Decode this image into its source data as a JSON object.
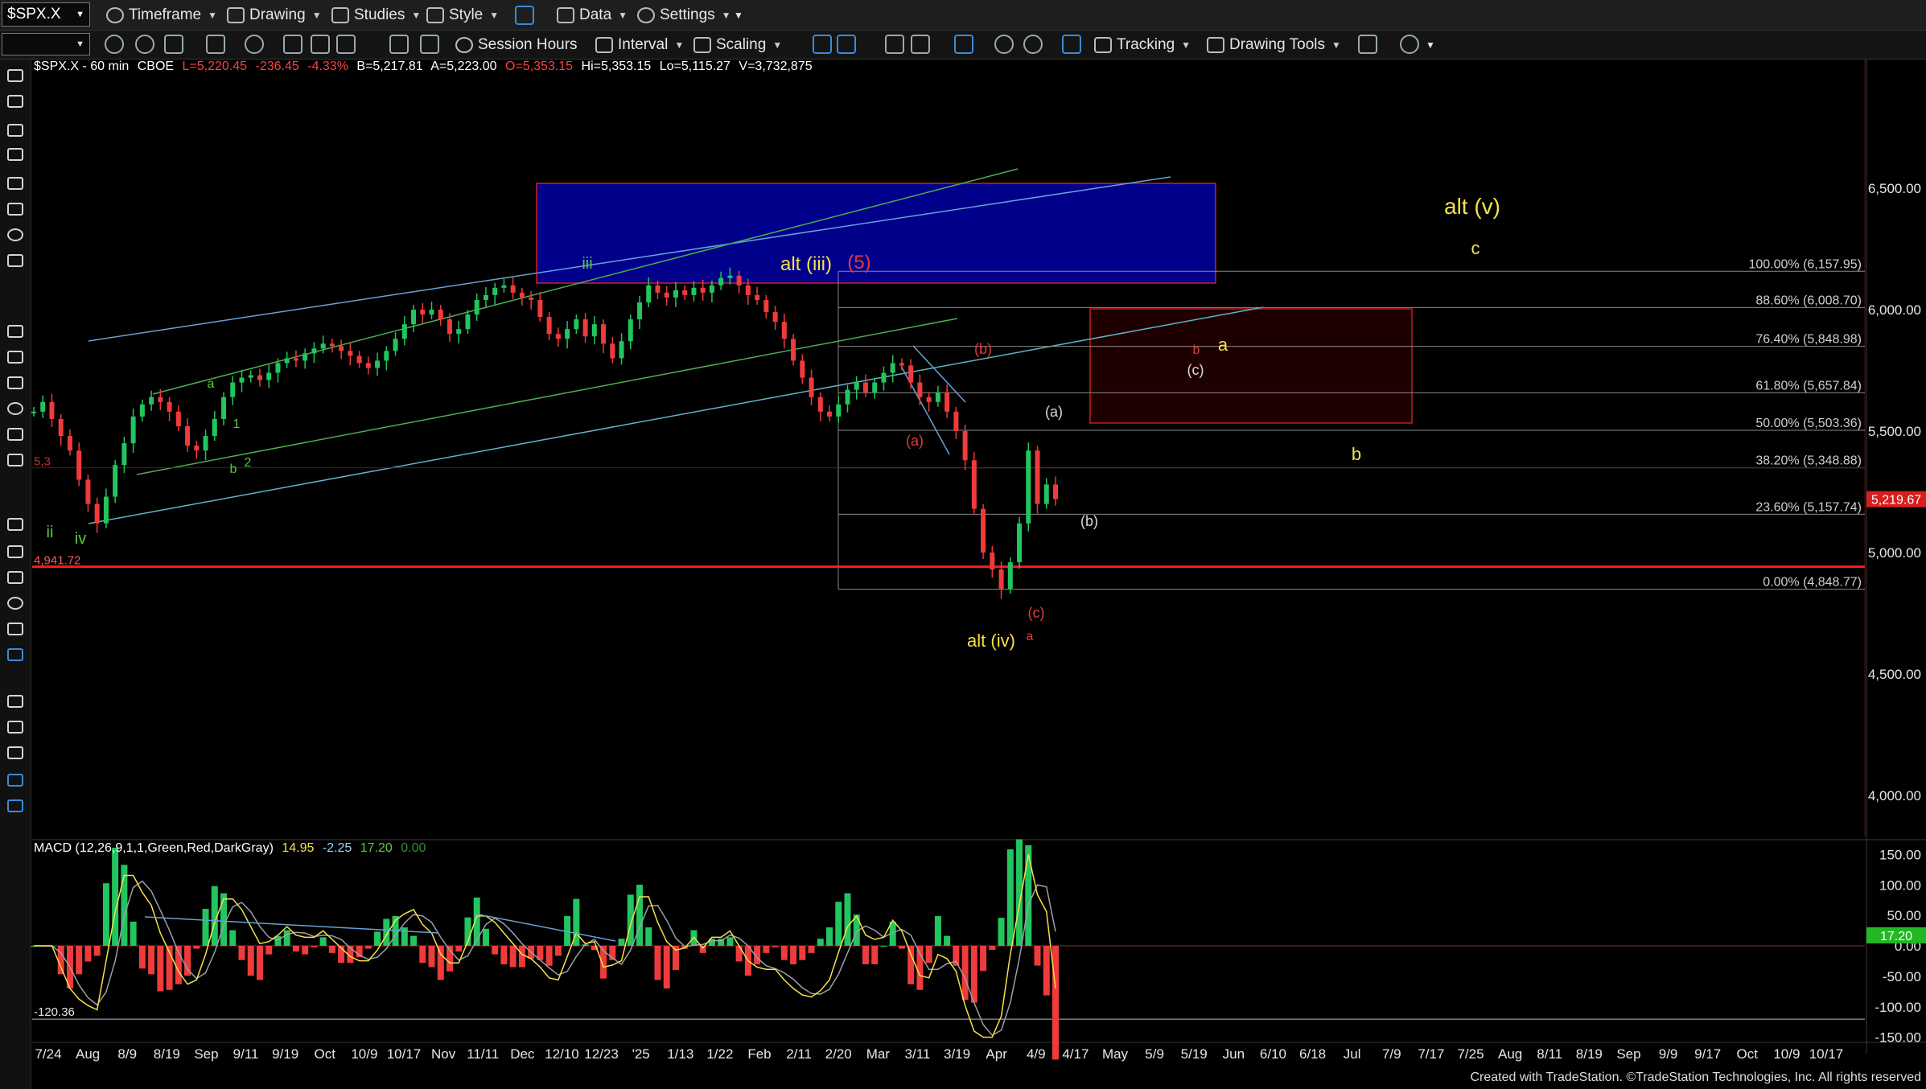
{
  "toolbar": {
    "symbol": "$SPX.X",
    "timeframe": "Timeframe",
    "drawing": "Drawing",
    "studies": "Studies",
    "style": "Style",
    "data": "Data",
    "settings": "Settings",
    "session_hours": "Session Hours",
    "interval": "Interval",
    "scaling": "Scaling",
    "tracking": "Tracking",
    "drawing_tools": "Drawing Tools"
  },
  "header": {
    "symbol_desc": "$SPX.X - 60 min",
    "exchange": "CBOE",
    "last": "L=5,220.45",
    "change": "-236.45",
    "change_pct": "-4.33%",
    "bid": "B=5,217.81",
    "ask": "A=5,223.00",
    "open": "O=5,353.15",
    "high": "Hi=5,353.15",
    "low": "Lo=5,115.27",
    "volume": "V=3,732,875"
  },
  "macd_header": {
    "name": "MACD (12,26,9,1,1,Green,Red,DarkGray)",
    "v1": "14.95",
    "v2": "-2.25",
    "v3": "17.20",
    "v4": "0.00"
  },
  "footer": "Created with TradeStation. ©TradeStation Technologies, Inc. All rights reserved",
  "colors": {
    "up": "#22c55e",
    "down": "#ef3b3b",
    "support_line": "#ff1a1a",
    "blue_box": "#00008b",
    "label_yellow": "#f5e14a",
    "label_green": "#5ac83c",
    "label_red": "#e23a3a"
  },
  "chart_data": {
    "type": "line",
    "y_axis_ticks": [
      "6,500.00",
      "6,000.00",
      "5,500.00",
      "5,000.00",
      "4,500.00",
      "4,000.00"
    ],
    "y_tick_values": [
      6500,
      6000,
      5500,
      5000,
      4500,
      4000
    ],
    "x_axis_ticks": [
      "7/24",
      "Aug",
      "8/9",
      "8/19",
      "Sep",
      "9/11",
      "9/19",
      "Oct",
      "10/9",
      "10/17",
      "Nov",
      "11/11",
      "Dec",
      "12/10",
      "12/23",
      "'25",
      "1/13",
      "1/22",
      "Feb",
      "2/11",
      "2/20",
      "Mar",
      "3/11",
      "3/19",
      "Apr",
      "4/9",
      "4/17",
      "May",
      "5/9",
      "5/19",
      "Jun",
      "6/10",
      "6/18",
      "Jul",
      "7/9",
      "7/17",
      "7/25",
      "Aug",
      "8/11",
      "8/19",
      "Sep",
      "9/9",
      "9/17",
      "Oct",
      "10/9",
      "10/17"
    ],
    "series": [
      {
        "values": [
          5580,
          5620,
          5550,
          5480,
          5420,
          5300,
          5200,
          5120,
          5230,
          5360,
          5450,
          5560,
          5610,
          5640,
          5620,
          5580,
          5520,
          5440,
          5420,
          5480,
          5550,
          5640,
          5700,
          5720,
          5730,
          5710,
          5740,
          5780,
          5800,
          5790,
          5820,
          5840,
          5860,
          5850,
          5830,
          5810,
          5780,
          5760,
          5790,
          5830,
          5880,
          5940,
          6000,
          5980,
          6000,
          5960,
          5900,
          5920,
          5980,
          6040,
          6060,
          6090,
          6100,
          6070,
          6050,
          6040,
          5970,
          5900,
          5880,
          5920,
          5960,
          5890,
          5940,
          5860,
          5800,
          5870,
          5960,
          6030,
          6100,
          6070,
          6050,
          6080,
          6060,
          6090,
          6070,
          6100,
          6130,
          6140,
          6100,
          6060,
          6040,
          5990,
          5950,
          5880,
          5790,
          5720,
          5640,
          5580,
          5560,
          5610,
          5670,
          5700,
          5660,
          5700,
          5740,
          5780,
          5770,
          5700,
          5640,
          5620,
          5660,
          5580,
          5500,
          5380,
          5180,
          5000,
          4930,
          4850,
          4960,
          5120,
          5420,
          5200,
          5280,
          5220
        ]
      }
    ],
    "last_value_label": "5,219.67",
    "support_level_label": "4,941.72",
    "support_value": 4941.72,
    "left_marker_label": "5,3",
    "last_value": 5219.67,
    "fib_levels": [
      {
        "label": "100.00% (6,157.95)",
        "value": 6157.95
      },
      {
        "label": "88.60% (6,008.70)",
        "value": 6008.7
      },
      {
        "label": "76.40% (5,848.98)",
        "value": 5848.98
      },
      {
        "label": "61.80% (5,657.84)",
        "value": 5657.84
      },
      {
        "label": "50.00% (5,503.36)",
        "value": 5503.36
      },
      {
        "label": "38.20% (5,348.88)",
        "value": 5348.88
      },
      {
        "label": "23.60% (5,157.74)",
        "value": 5157.74
      },
      {
        "label": "0.00% (4,848.77)",
        "value": 4848.77
      }
    ],
    "wave_labels": [
      {
        "text": "ii",
        "color": "green"
      },
      {
        "text": "iv",
        "color": "green"
      },
      {
        "text": "a",
        "color": "green"
      },
      {
        "text": "1",
        "color": "green"
      },
      {
        "text": "b",
        "color": "green"
      },
      {
        "text": "2",
        "color": "green"
      },
      {
        "text": "iii",
        "color": "green"
      },
      {
        "text": "alt (iii)",
        "color": "yellow"
      },
      {
        "text": "(5)",
        "color": "red"
      },
      {
        "text": "(a)",
        "color": "red"
      },
      {
        "text": "(b)",
        "color": "red"
      },
      {
        "text": "(c)",
        "color": "red"
      },
      {
        "text": "a",
        "color": "red"
      },
      {
        "text": "alt (iv)",
        "color": "yellow"
      },
      {
        "text": "(a)",
        "color": "white"
      },
      {
        "text": "(b)",
        "color": "white"
      },
      {
        "text": "(c)",
        "color": "white"
      },
      {
        "text": "b",
        "color": "red"
      },
      {
        "text": "a",
        "color": "yellow"
      },
      {
        "text": "b",
        "color": "yellow"
      },
      {
        "text": "alt (v)",
        "color": "yellow"
      },
      {
        "text": "c",
        "color": "yellow"
      }
    ],
    "macd": {
      "y_axis_ticks": [
        "150.00",
        "100.00",
        "50.00",
        "0.00",
        "-50.00",
        "-100.00",
        "-150.00"
      ],
      "y_tick_values": [
        150,
        100,
        50,
        0,
        -50,
        -100,
        -150
      ],
      "last_label": "17.20",
      "last_value": 17.2,
      "min_label": "-120.36",
      "min_value": -120.36
    }
  }
}
